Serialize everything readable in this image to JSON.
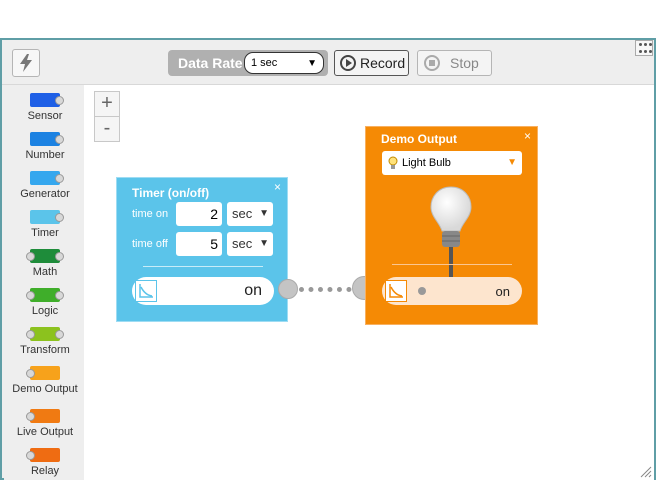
{
  "toolbar": {
    "data_rate_label": "Data Rate",
    "data_rate_value": "1 sec",
    "record_label": "Record",
    "stop_label": "Stop"
  },
  "palette": {
    "items": [
      {
        "label": "Sensor",
        "color": "#1e5fe6"
      },
      {
        "label": "Number",
        "color": "#1c82e2"
      },
      {
        "label": "Generator",
        "color": "#35a7ee"
      },
      {
        "label": "Timer",
        "color": "#5bc4ea"
      },
      {
        "label": "Math",
        "color": "#1e8c3a"
      },
      {
        "label": "Logic",
        "color": "#3fae2a"
      },
      {
        "label": "Transform",
        "color": "#8cc21e"
      },
      {
        "label": "Demo Output",
        "color": "#f7a21b"
      },
      {
        "label": "Live Output",
        "color": "#f07a12"
      },
      {
        "label": "Relay",
        "color": "#ef6c12"
      }
    ]
  },
  "zoom": {
    "in_label": "+",
    "out_label": "-"
  },
  "timer": {
    "title": "Timer (on/off)",
    "close": "×",
    "time_on_label": "time on",
    "time_on_value": "2",
    "time_on_unit": "sec",
    "time_off_label": "time off",
    "time_off_value": "5",
    "time_off_unit": "sec",
    "output_value": "on",
    "color": "#5bc4ea"
  },
  "demo_output": {
    "title": "Demo Output",
    "close": "×",
    "device": "Light Bulb",
    "input_value": "on",
    "color": "#f58a05"
  },
  "icons": {
    "bolt": "lightning-bolt-icon",
    "grid": "grid-dots-icon",
    "bulb": "light-bulb-icon",
    "graph": "graph-icon"
  }
}
